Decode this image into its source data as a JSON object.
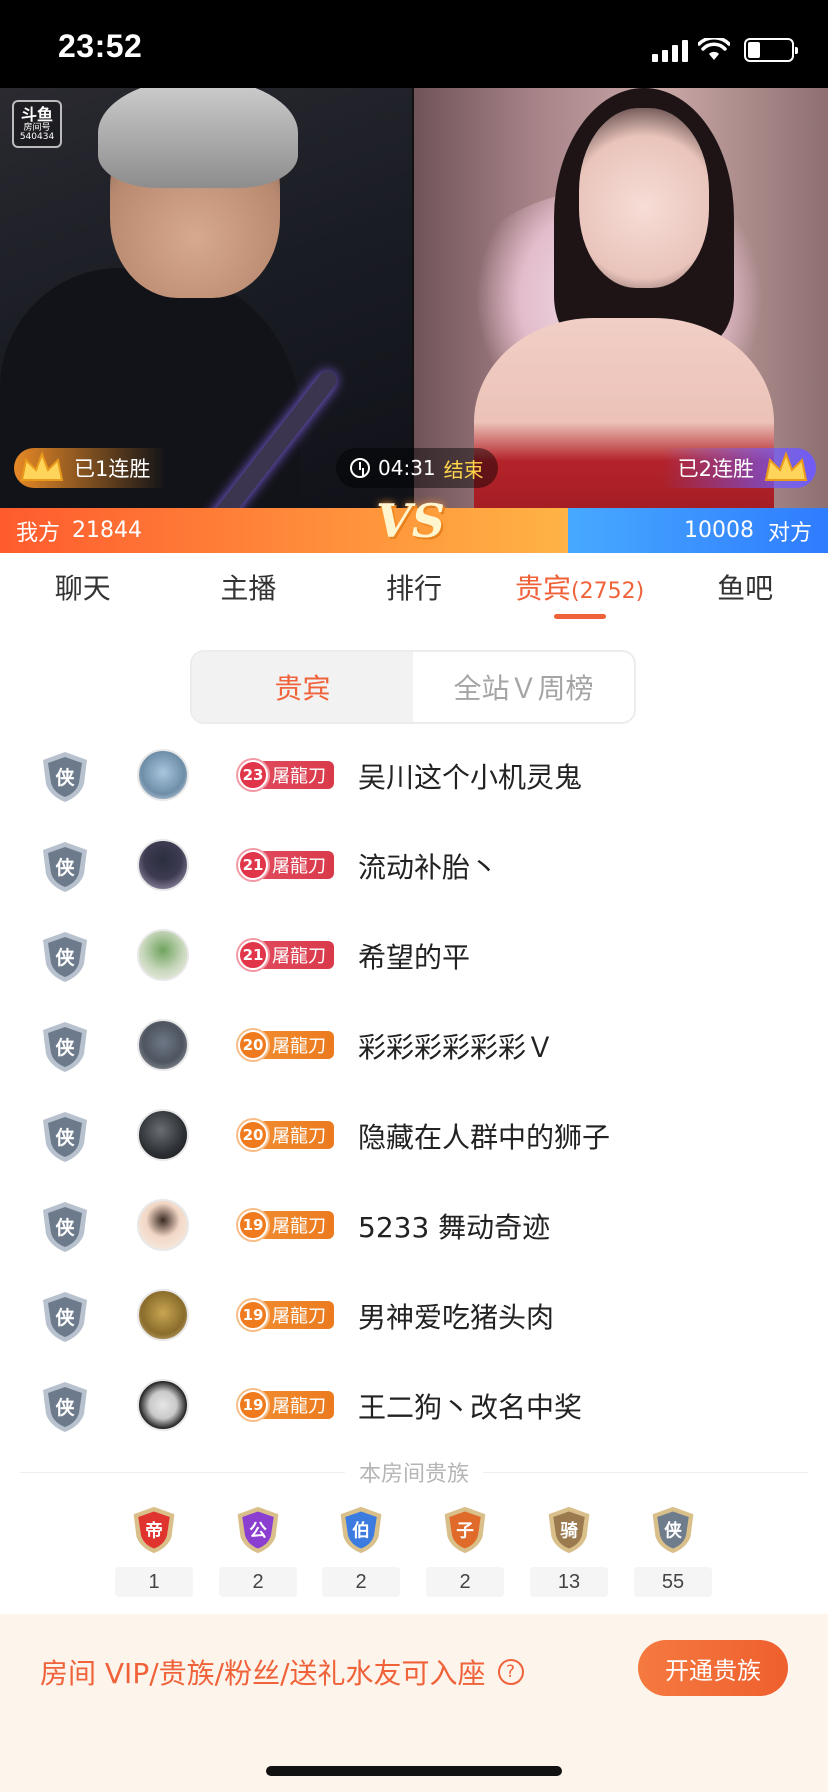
{
  "status_bar": {
    "time": "23:52",
    "icons": [
      "signal-icon",
      "wifi-icon",
      "battery-icon"
    ]
  },
  "video": {
    "room_logo_lines": [
      "斗鱼",
      "房间号",
      "540434"
    ],
    "left_streak": "已1连胜",
    "right_streak": "已2连胜",
    "timer": "04:31",
    "timer_state": "结束",
    "vs_text": "VS",
    "pk": {
      "our_label": "我方",
      "our_score": "21844",
      "their_score": "10008",
      "their_label": "对方",
      "our_share": 0.686
    }
  },
  "tabs": [
    {
      "label": "聊天",
      "active": false
    },
    {
      "label": "主播",
      "active": false
    },
    {
      "label": "排行",
      "active": false
    },
    {
      "label": "贵宾",
      "count": "(2752)",
      "active": true
    },
    {
      "label": "鱼吧",
      "active": false
    }
  ],
  "segment": {
    "left": "贵宾",
    "right": "全站Ｖ周榜",
    "active": "left"
  },
  "guests": [
    {
      "shield": "侠",
      "level": "23",
      "medal": "屠龍刀",
      "tier": "red",
      "name": "吴川这个小机灵鬼",
      "avatar": "shark"
    },
    {
      "shield": "侠",
      "level": "21",
      "medal": "屠龍刀",
      "tier": "red",
      "name": "流动补胎丶",
      "avatar": "hair"
    },
    {
      "shield": "侠",
      "level": "21",
      "medal": "屠龍刀",
      "tier": "red",
      "name": "希望的平",
      "avatar": "plant"
    },
    {
      "shield": "侠",
      "level": "20",
      "medal": "屠龍刀",
      "tier": "orange",
      "name": "彩彩彩彩彩彩Ｖ",
      "avatar": "room"
    },
    {
      "shield": "侠",
      "level": "20",
      "medal": "屠龍刀",
      "tier": "orange",
      "name": "隐藏在人群中的狮子",
      "avatar": "dark"
    },
    {
      "shield": "侠",
      "level": "19",
      "medal": "屠龍刀",
      "tier": "orange",
      "name": "5233 舞动奇迹",
      "avatar": "kid"
    },
    {
      "shield": "侠",
      "level": "19",
      "medal": "屠龍刀",
      "tier": "orange",
      "name": "男神爱吃猪头肉",
      "avatar": "gold"
    },
    {
      "shield": "侠",
      "level": "19",
      "medal": "屠龍刀",
      "tier": "orange",
      "name": "王二狗丶改名中奖",
      "avatar": "meme"
    }
  ],
  "nobility": {
    "title": "本房间贵族",
    "ranks": [
      {
        "glyph": "帝",
        "count": "1",
        "color": "#e0342e"
      },
      {
        "glyph": "公",
        "count": "2",
        "color": "#8a3fd0"
      },
      {
        "glyph": "伯",
        "count": "2",
        "color": "#3c7be0"
      },
      {
        "glyph": "子",
        "count": "2",
        "color": "#e06a2a"
      },
      {
        "glyph": "骑",
        "count": "13",
        "color": "#9a7a4e"
      },
      {
        "glyph": "侠",
        "count": "55",
        "color": "#6f7c8c"
      }
    ]
  },
  "bottom": {
    "text": "房间 VIP/贵族/粉丝/送礼水友可入座",
    "button": "开通贵族"
  },
  "colors": {
    "accent": "#f0623a",
    "medal_red": "#e1354a",
    "medal_orange": "#f07b1e",
    "pk_left": "#ff8c3b",
    "pk_right": "#2f7cff"
  }
}
